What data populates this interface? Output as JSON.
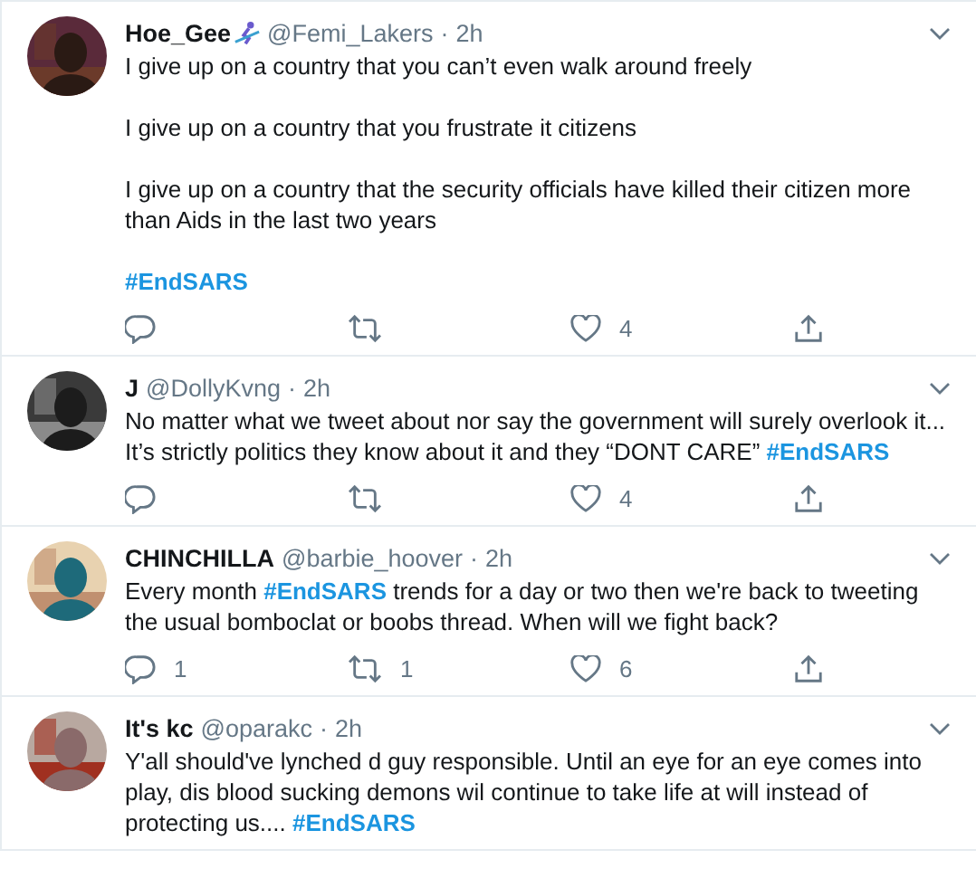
{
  "tweets": [
    {
      "name": "Hoe_Gee",
      "handle": "@Femi_Lakers",
      "separator": "·",
      "time": "2h",
      "emoji": true,
      "paragraphs": [
        "I give up on a country that you can’t even walk around freely",
        "I give up on a country that you frustrate it citizens",
        "I give up on a country that the security officials have killed their citizen more than Aids in the last two years",
        "**#EndSARS**"
      ],
      "actions": {
        "like": "4"
      }
    },
    {
      "name": "J",
      "handle": "@DollyKvng",
      "separator": "·",
      "time": "2h",
      "emoji": false,
      "paragraphs": [
        "No matter what we tweet about nor say the government will surely overlook it... It’s strictly politics they know about it and they “DONT CARE” **#EndSARS**"
      ],
      "actions": {
        "like": "4"
      }
    },
    {
      "name": "CHINCHILLA",
      "handle": "@barbie_hoover",
      "separator": "·",
      "time": "2h",
      "emoji": false,
      "paragraphs": [
        "Every month **#EndSARS** trends for a day or two then we're back to tweeting the usual bomboclat or boobs thread. When will we fight back?"
      ],
      "actions": {
        "reply": "1",
        "retweet": "1",
        "like": "6"
      }
    },
    {
      "name": "It's kc",
      "handle": "@oparakc",
      "separator": "·",
      "time": "2h",
      "emoji": false,
      "paragraphs": [
        "Y'all should've lynched d guy responsible. Until an eye for an eye comes into play, dis blood sucking demons wil continue to take life at will instead of protecting us.... **#EndSARS**"
      ]
    }
  ]
}
